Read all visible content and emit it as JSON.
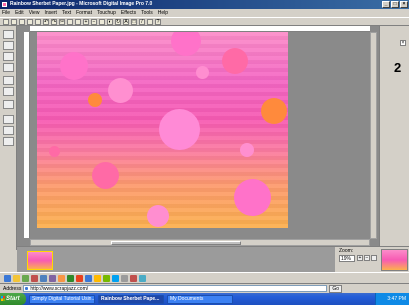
{
  "window": {
    "title": "Rainbow Sherbet Paper.jpg - Microsoft Digital Image Pro 7.0"
  },
  "menu": [
    "File",
    "Edit",
    "View",
    "Insert",
    "Text",
    "Format",
    "Touchup",
    "Effects",
    "Tools",
    "Help"
  ],
  "zoom": {
    "label": "Zoom:",
    "value": "19%"
  },
  "right_panel": {
    "number": "2"
  },
  "address": {
    "label": "Address",
    "url": "http://www.scrapjazz.com/",
    "go_label": "Go"
  },
  "taskbar": {
    "start": "Start",
    "tasks": [
      "Simply Digital Tutorial Usin...",
      "Rainbow Sherbet Pape...",
      "My Documents"
    ],
    "clock": "3:47 PM"
  },
  "colors": {
    "title_bar": "#0a246a",
    "canvas_top": "#fc8dc9",
    "canvas_mid": "#f75bb3",
    "canvas_bottom": "#fcb04e",
    "taskbar": "#245dd8"
  }
}
